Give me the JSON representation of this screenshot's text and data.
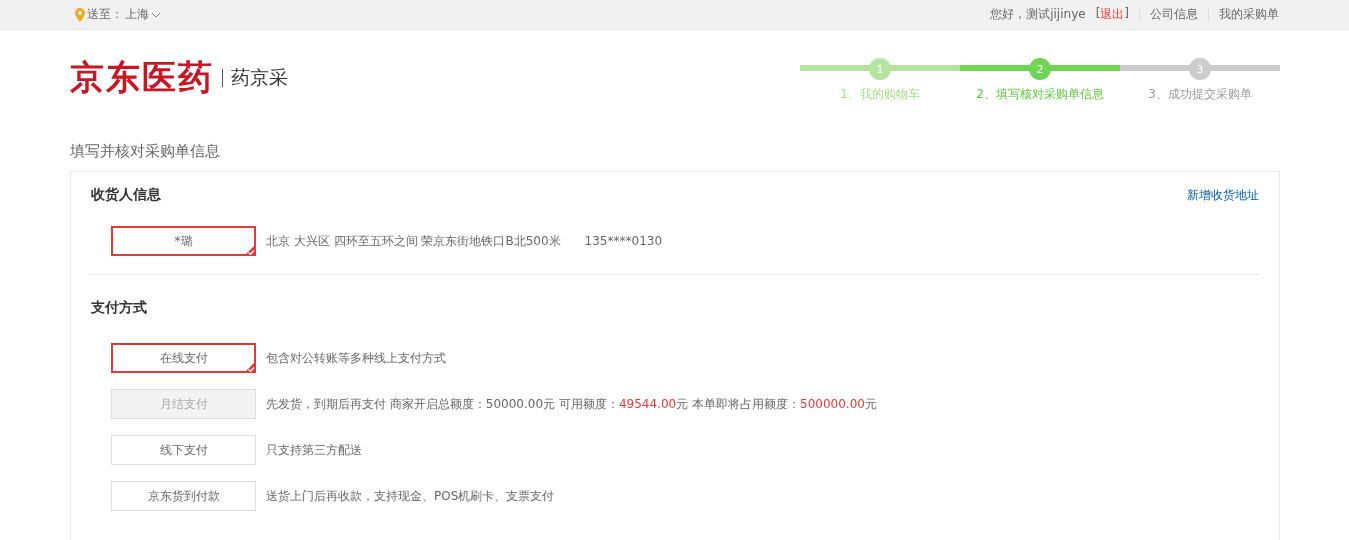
{
  "top_bar": {
    "location_label": "送至：",
    "location": "上海",
    "greeting": "您好，测试jijinye",
    "logout_open": "[",
    "logout": "退出",
    "logout_close": "]",
    "links": [
      "公司信息",
      "我的采购单"
    ]
  },
  "header": {
    "logo": "京东医药",
    "sub_logo": "药京采",
    "steps": [
      {
        "number": "1",
        "label": "1、我的购物车",
        "kind": "done"
      },
      {
        "number": "2",
        "label": "2、填写核对采购单信息",
        "kind": "current"
      },
      {
        "number": "3",
        "label": "3、成功提交采购单",
        "kind": "todo"
      }
    ]
  },
  "page_title": "填写并核对采购单信息",
  "consignee": {
    "heading": "收货人信息",
    "add_link": "新增收货地址",
    "addresses": [
      {
        "name": "*璐",
        "selected": true,
        "address": "北京 大兴区 四环至五环之间 荣京东街地铁口B北500米",
        "phone": "135****0130"
      }
    ]
  },
  "payment": {
    "heading": "支付方式",
    "options": [
      {
        "label": "在线支付",
        "selected": true,
        "disabled": false,
        "description": [
          {
            "kind": "plain",
            "text": "包含对公转账等多种线上支付方式"
          }
        ]
      },
      {
        "label": "月结支付",
        "selected": false,
        "disabled": true,
        "description": [
          {
            "kind": "plain",
            "text": "先发货，到期后再支付 商家开启总额度："
          },
          {
            "kind": "number",
            "text": "50000.00"
          },
          {
            "kind": "plain",
            "text": "元 可用额度："
          },
          {
            "kind": "highlight",
            "text": "49544.00"
          },
          {
            "kind": "plain",
            "text": "元 本单即将占用额度："
          },
          {
            "kind": "highlight",
            "text": "500000.00"
          },
          {
            "kind": "plain",
            "text": "元"
          }
        ]
      },
      {
        "label": "线下支付",
        "selected": false,
        "disabled": false,
        "description": [
          {
            "kind": "plain",
            "text": "只支持第三方配送"
          }
        ]
      },
      {
        "label": "京东货到付款",
        "selected": false,
        "disabled": false,
        "description": [
          {
            "kind": "plain",
            "text": "送货上门后再收款，支持现金、POS机刷卡、支票支付"
          }
        ]
      }
    ]
  }
}
